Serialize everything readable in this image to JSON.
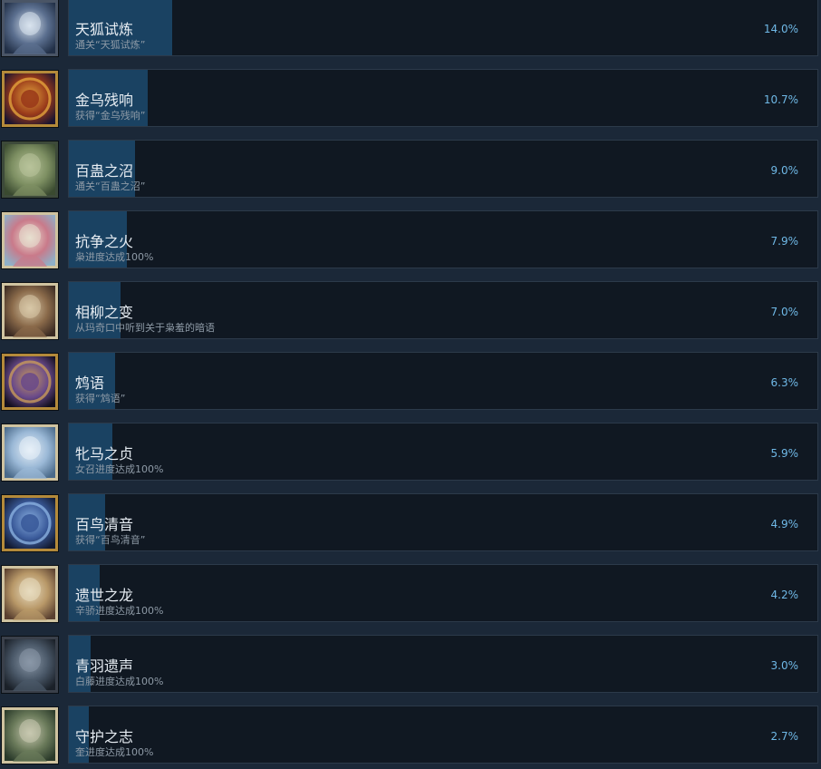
{
  "achievements": [
    {
      "name": "天狐试炼",
      "description": "通关“天狐试炼”",
      "percent": "14.0%",
      "rate": 14.0,
      "icon": "snowy-mountain-icon",
      "frame": "#4a5566",
      "tones": [
        "#223047",
        "#5b6f8f",
        "#d9e3ee"
      ]
    },
    {
      "name": "金乌残响",
      "description": "获得“金乌残响”",
      "percent": "10.7%",
      "rate": 10.7,
      "icon": "golden-crow-emblem-icon",
      "frame": "#b48a3a",
      "tones": [
        "#1c1530",
        "#9a3a1a",
        "#e2a33c"
      ]
    },
    {
      "name": "百蛊之沼",
      "description": "通关“百蛊之沼”",
      "percent": "9.0%",
      "rate": 9.0,
      "icon": "swamp-cabbage-icon",
      "frame": "#3d4a3a",
      "tones": [
        "#3a4a30",
        "#7d8f62",
        "#b8c39a"
      ]
    },
    {
      "name": "抗争之火",
      "description": "枭进度达成100%",
      "percent": "7.9%",
      "rate": 7.9,
      "icon": "red-haired-girl-icon",
      "frame": "#cfc3a0",
      "tones": [
        "#8fb0c8",
        "#c97a8a",
        "#e8e0d0"
      ]
    },
    {
      "name": "相柳之变",
      "description": "从玛奇口中听到关于枭羞的暗语",
      "percent": "7.0%",
      "rate": 7.0,
      "icon": "dark-haired-woman-icon",
      "frame": "#cfc3a0",
      "tones": [
        "#3a2a22",
        "#8a6a4a",
        "#d8c8a8"
      ]
    },
    {
      "name": "鸩语",
      "description": "获得“鸩语”",
      "percent": "6.3%",
      "rate": 6.3,
      "icon": "wooden-staff-emblem-icon",
      "frame": "#b48a3a",
      "tones": [
        "#120f1e",
        "#6a4a8a",
        "#c89a5a"
      ]
    },
    {
      "name": "牝马之贞",
      "description": "女召进度达成100%",
      "percent": "5.9%",
      "rate": 5.9,
      "icon": "ice-maiden-icon",
      "frame": "#cfc3a0",
      "tones": [
        "#4a6a8a",
        "#9ab8d6",
        "#e8f0f8"
      ]
    },
    {
      "name": "百鸟清音",
      "description": "获得“百鸟清音”",
      "percent": "4.9%",
      "rate": 4.9,
      "icon": "blue-bird-emblem-icon",
      "frame": "#b48a3a",
      "tones": [
        "#121a30",
        "#3a5a9a",
        "#8ab0e0"
      ]
    },
    {
      "name": "遗世之龙",
      "description": "辛骄进度达成100%",
      "percent": "4.2%",
      "rate": 4.2,
      "icon": "blonde-warrior-icon",
      "frame": "#cfc3a0",
      "tones": [
        "#5a4030",
        "#b89868",
        "#e8dcc0"
      ]
    },
    {
      "name": "青羽遗声",
      "description": "白藤进度达成100%",
      "percent": "3.0%",
      "rate": 3.0,
      "icon": "dark-cloaked-figure-icon",
      "frame": "#3a404a",
      "tones": [
        "#1a2028",
        "#4a5868",
        "#8a98a8"
      ]
    },
    {
      "name": "守护之志",
      "description": "奎进度达成100%",
      "percent": "2.7%",
      "rate": 2.7,
      "icon": "masked-boy-icon",
      "frame": "#cfc3a0",
      "tones": [
        "#2a3a2a",
        "#6a7a5a",
        "#c8c8b0"
      ]
    }
  ]
}
